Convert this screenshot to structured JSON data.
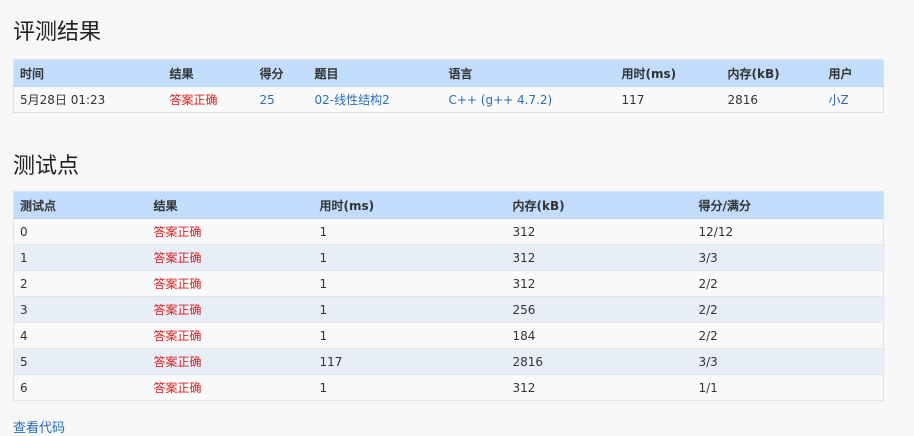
{
  "submission": {
    "title": "评测结果",
    "headers": [
      "时间",
      "结果",
      "得分",
      "题目",
      "语言",
      "用时(ms)",
      "内存(kB)",
      "用户"
    ],
    "row": {
      "time": "5月28日 01:23",
      "result": "答案正确",
      "score": "25",
      "problem": "02-线性结构2",
      "language": "C++ (g++ 4.7.2)",
      "time_ms": "117",
      "memory_kb": "2816",
      "user": "小Z"
    }
  },
  "test_points": {
    "title": "测试点",
    "headers": [
      "测试点",
      "结果",
      "用时(ms)",
      "内存(kB)",
      "得分/满分"
    ],
    "rows": [
      {
        "id": "0",
        "result": "答案正确",
        "time_ms": "1",
        "memory_kb": "312",
        "score": "12/12"
      },
      {
        "id": "1",
        "result": "答案正确",
        "time_ms": "1",
        "memory_kb": "312",
        "score": "3/3"
      },
      {
        "id": "2",
        "result": "答案正确",
        "time_ms": "1",
        "memory_kb": "312",
        "score": "2/2"
      },
      {
        "id": "3",
        "result": "答案正确",
        "time_ms": "1",
        "memory_kb": "256",
        "score": "2/2"
      },
      {
        "id": "4",
        "result": "答案正确",
        "time_ms": "1",
        "memory_kb": "184",
        "score": "2/2"
      },
      {
        "id": "5",
        "result": "答案正确",
        "time_ms": "117",
        "memory_kb": "2816",
        "score": "3/3"
      },
      {
        "id": "6",
        "result": "答案正确",
        "time_ms": "1",
        "memory_kb": "312",
        "score": "1/1"
      }
    ]
  },
  "view_code_label": "查看代码",
  "colors": {
    "header_bg": "#c2dcfb",
    "accepted": "#d81e1e",
    "link": "#2a6db3",
    "stripe": "#e8eef8"
  }
}
